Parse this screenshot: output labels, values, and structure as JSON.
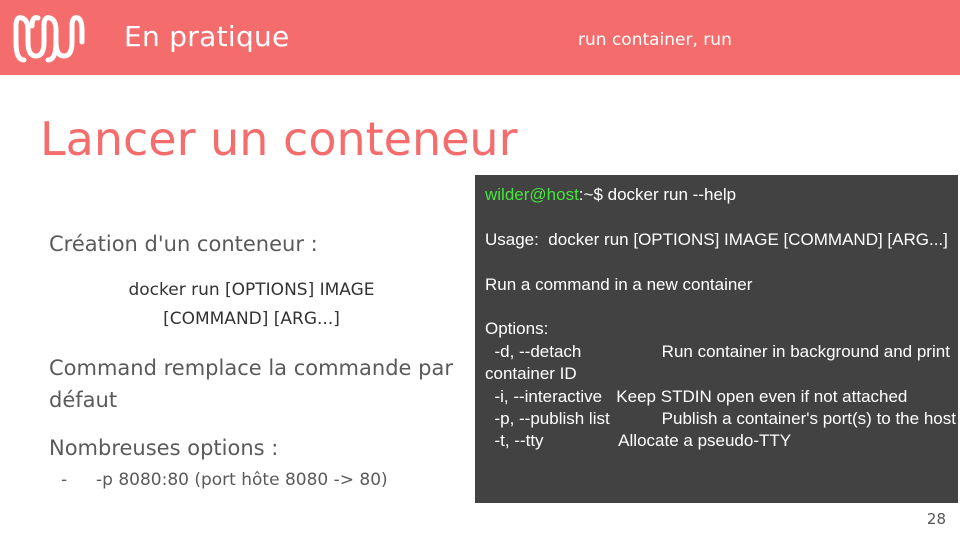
{
  "header": {
    "title": "En pratique",
    "subtitle": "run container, run"
  },
  "slide": {
    "title": "Lancer un conteneur",
    "para1": "Création d'un conteneur :",
    "command_line1": "docker run [OPTIONS] IMAGE",
    "command_line2": "[COMMAND] [ARG...]",
    "para2": "Command remplace la commande par défaut",
    "para3": "Nombreuses options :",
    "bullet_dash": "-",
    "bullet1": "-p 8080:80 (port hôte 8080 -> 80)",
    "page_number": "28"
  },
  "terminal": {
    "prompt_user": "wilder@host",
    "prompt_rest": ":~$ docker run --help",
    "lines": [
      "",
      "Usage:  docker run [OPTIONS] IMAGE [COMMAND] [ARG...]",
      "",
      "Run a command in a new container",
      "",
      "Options:",
      "  -d, --detach                 Run container in background and print container ID",
      "  -i, --interactive   Keep STDIN open even if not attached",
      "  -p, --publish list           Publish a container's port(s) to the host",
      "  -t, --tty                Allocate a pseudo-TTY"
    ]
  },
  "colors": {
    "brand": "#f56c6c",
    "terminal_bg": "#424242",
    "prompt_green": "#44e63c"
  }
}
